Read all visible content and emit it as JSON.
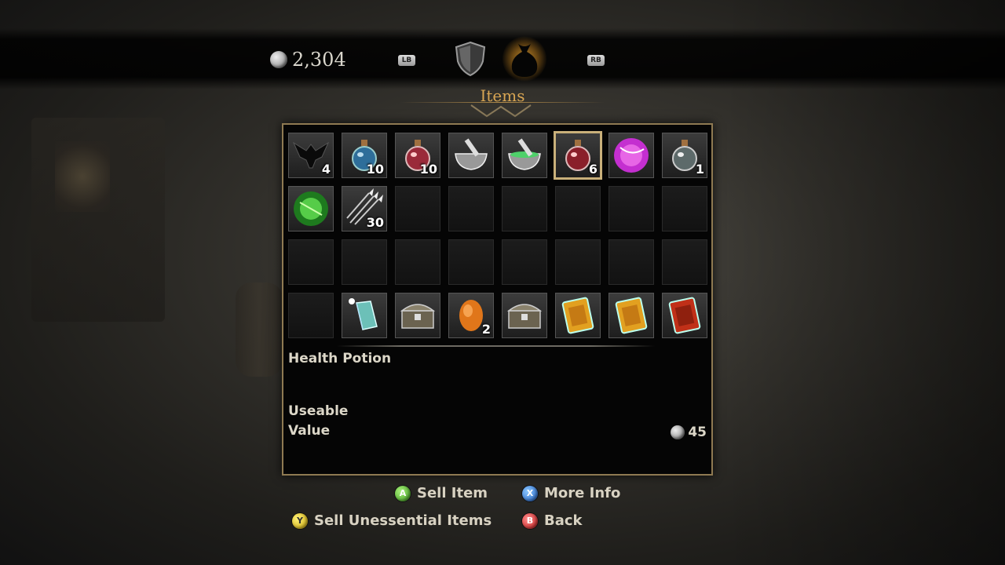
{
  "header": {
    "gold_amount": "2,304",
    "left_bumper": "LB",
    "right_bumper": "RB",
    "tabs": [
      {
        "icon": "shield-icon",
        "active": false
      },
      {
        "icon": "coin-bag-icon",
        "active": true
      }
    ],
    "title": "Items"
  },
  "inventory": {
    "slots": [
      {
        "icon": "raven-icon",
        "qty": "4"
      },
      {
        "icon": "blue-potion-icon",
        "qty": "10"
      },
      {
        "icon": "red-potion-icon",
        "qty": "10"
      },
      {
        "icon": "mortar-pestle-icon",
        "qty": ""
      },
      {
        "icon": "green-mortar-icon",
        "qty": ""
      },
      {
        "icon": "health-potion-icon",
        "qty": "6",
        "selected": true
      },
      {
        "icon": "purple-orb-icon",
        "qty": ""
      },
      {
        "icon": "grey-potion-icon",
        "qty": "1"
      },
      {
        "icon": "green-gem-icon",
        "qty": ""
      },
      {
        "icon": "arrows-icon",
        "qty": "30"
      },
      {
        "icon": "",
        "qty": ""
      },
      {
        "icon": "",
        "qty": ""
      },
      {
        "icon": "",
        "qty": ""
      },
      {
        "icon": "",
        "qty": ""
      },
      {
        "icon": "",
        "qty": ""
      },
      {
        "icon": "",
        "qty": ""
      },
      {
        "icon": "",
        "qty": ""
      },
      {
        "icon": "",
        "qty": ""
      },
      {
        "icon": "",
        "qty": ""
      },
      {
        "icon": "",
        "qty": ""
      },
      {
        "icon": "",
        "qty": ""
      },
      {
        "icon": "",
        "qty": ""
      },
      {
        "icon": "",
        "qty": ""
      },
      {
        "icon": "",
        "qty": ""
      },
      {
        "icon": "",
        "qty": ""
      },
      {
        "icon": "crystal-icon",
        "qty": ""
      },
      {
        "icon": "chest-icon",
        "qty": ""
      },
      {
        "icon": "amber-gem-icon",
        "qty": "2"
      },
      {
        "icon": "chest-icon",
        "qty": ""
      },
      {
        "icon": "gold-card-icon",
        "qty": ""
      },
      {
        "icon": "gold-card-icon",
        "qty": ""
      },
      {
        "icon": "red-card-icon",
        "qty": ""
      }
    ]
  },
  "details": {
    "name": "Health Potion",
    "type": "Useable",
    "value_label": "Value",
    "value": "45"
  },
  "prompts": [
    {
      "button": "A",
      "label": "Sell Item"
    },
    {
      "button": "X",
      "label": "More Info"
    },
    {
      "button": "Y",
      "label": "Sell Unessential Items"
    },
    {
      "button": "B",
      "label": "Back"
    }
  ],
  "colors": {
    "title_accent": "#d8a553",
    "panel_border": "#8f7a52",
    "selected_border": "#c9b07a"
  }
}
